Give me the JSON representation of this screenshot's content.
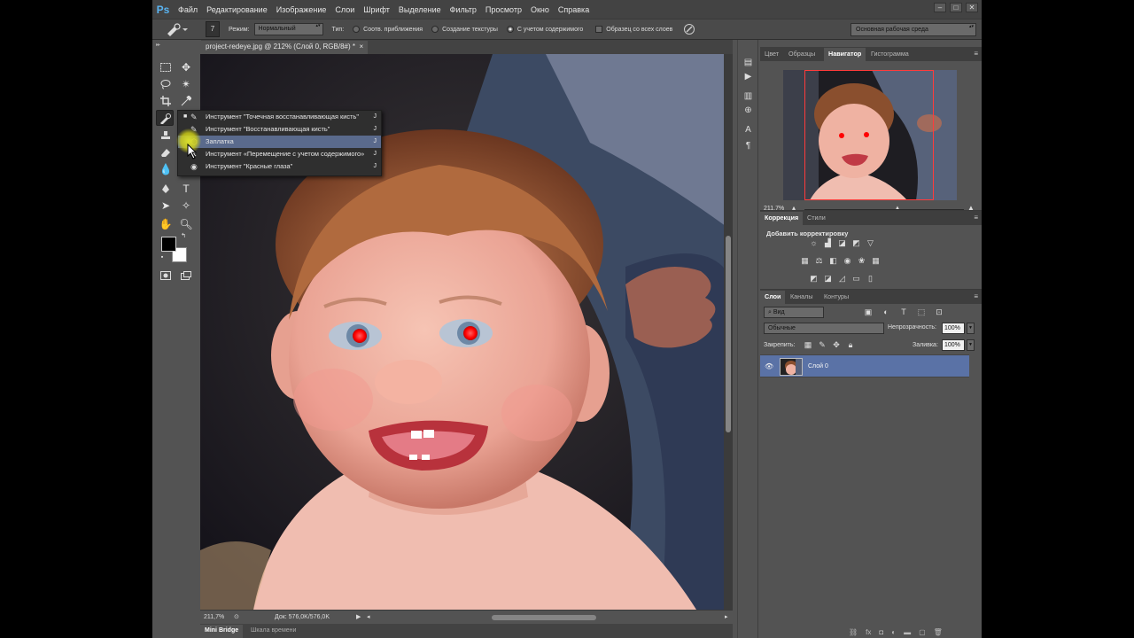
{
  "app": {
    "logo": "Ps",
    "menu": [
      "Файл",
      "Редактирование",
      "Изображение",
      "Слои",
      "Шрифт",
      "Выделение",
      "Фильтр",
      "Просмотр",
      "Окно",
      "Справка"
    ],
    "window_buttons": [
      "–",
      "□",
      "✕"
    ]
  },
  "options": {
    "brush_size": "7",
    "mode_label": "Режим:",
    "mode_value": "Нормальный",
    "type_label": "Тип:",
    "type_options": [
      "Соотв. приближения",
      "Создание текстуры",
      "С учетом содержимого"
    ],
    "type_selected_index": 2,
    "sample_all_layers": "Образец со всех слоев",
    "workspace": "Основная рабочая среда"
  },
  "document": {
    "tab_title": "project-redeye.jpg @ 212% (Слой 0, RGB/8#) *",
    "zoom": "211,7%",
    "doc_info": "Док: 576,0K/576,0K",
    "bottom_tabs": [
      "Mini Bridge",
      "Шкала времени"
    ]
  },
  "flyout": {
    "items": [
      {
        "label": "Инструмент \"Точечная восстанавливающая кисть\"",
        "shortcut": "J",
        "icon": "spot-healing-brush-icon",
        "glyph": "✎",
        "selected": true,
        "highlighted": false
      },
      {
        "label": "Инструмент \"Восстанавливающая кисть\"",
        "shortcut": "J",
        "icon": "healing-brush-icon",
        "glyph": "✎",
        "selected": false,
        "highlighted": false
      },
      {
        "label": "Заплатка",
        "shortcut": "J",
        "icon": "patch-tool-icon",
        "glyph": "⬡",
        "selected": false,
        "highlighted": true
      },
      {
        "label": "Инструмент «Перемещение с учетом содержимого»",
        "shortcut": "J",
        "icon": "content-aware-move-icon",
        "glyph": "✕",
        "selected": false,
        "highlighted": false
      },
      {
        "label": "Инструмент \"Красные глаза\"",
        "shortcut": "J",
        "icon": "red-eye-tool-icon",
        "glyph": "◉",
        "selected": false,
        "highlighted": false
      }
    ]
  },
  "navigator": {
    "tabs": [
      "Цвет",
      "Образцы",
      "Навигатор",
      "Гистограмма"
    ],
    "active_tab_index": 2,
    "zoom": "211,7%"
  },
  "adjustments": {
    "tabs": [
      "Коррекция",
      "Стили"
    ],
    "active_tab_index": 0,
    "title": "Добавить корректировку"
  },
  "layers": {
    "tabs": [
      "Слои",
      "Каналы",
      "Контуры"
    ],
    "active_tab_index": 0,
    "filter": "Вид",
    "blend_mode": "Обычные",
    "opacity_label": "Непрозрачность:",
    "opacity_value": "100%",
    "lock_label": "Закрепить:",
    "fill_label": "Заливка:",
    "fill_value": "100%",
    "layer_name": "Слой 0"
  },
  "colors": {
    "accent_highlight": "#5a6a8c",
    "layer_selected": "#5a72a6",
    "navigator_frame": "#ff3b3b",
    "cursor_glow": "#e2e628"
  }
}
